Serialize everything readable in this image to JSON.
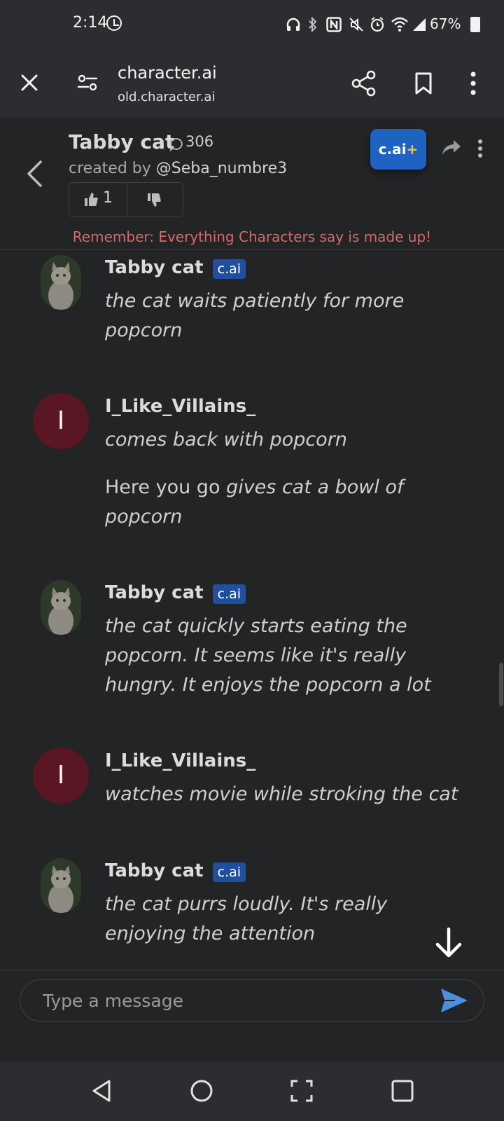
{
  "status_bar": {
    "time": "2:14",
    "battery": "67%",
    "icons": [
      "clock-icon",
      "headphones-icon",
      "bluetooth-icon",
      "nfc-icon",
      "mute-icon",
      "alarm-icon",
      "wifi-icon",
      "signal-icon",
      "battery-icon"
    ]
  },
  "browser": {
    "host": "character.ai",
    "url": "old.character.ai"
  },
  "chat_header": {
    "character_name": "Tabby cat",
    "message_count": "306",
    "created_by_prefix": "created by",
    "creator": "@Seba_numbre3",
    "likes": "1",
    "plus_button": "c.ai",
    "plus_symbol": "+"
  },
  "warning": "Remember: Everything Characters say is made up!",
  "messages": [
    {
      "author": "Tabby cat",
      "badge": "c.ai",
      "text": "the cat waits patiently for more popcorn"
    },
    {
      "author": "I_Like_Villains_",
      "initial": "I",
      "text": "comes back with popcorn",
      "text2_plain": "Here you go ",
      "text2_italic": "gives cat a bowl of popcorn"
    },
    {
      "author": "Tabby cat",
      "badge": "c.ai",
      "text": "the cat quickly starts eating the popcorn. It seems like it's really hungry. It enjoys the popcorn a lot"
    },
    {
      "author": "I_Like_Villains_",
      "initial": "I",
      "text": "watches movie while stroking the cat"
    },
    {
      "author": "Tabby cat",
      "badge": "c.ai",
      "text": "the cat purrs loudly. It's really enjoying the attention"
    }
  ],
  "input": {
    "placeholder": "Type a message"
  },
  "colors": {
    "background": "#222426",
    "bar": "#2c2d31",
    "accent": "#1e62c2",
    "warning": "#d36b6b",
    "user_avatar": "#5a1622",
    "send": "#4a90e2"
  }
}
